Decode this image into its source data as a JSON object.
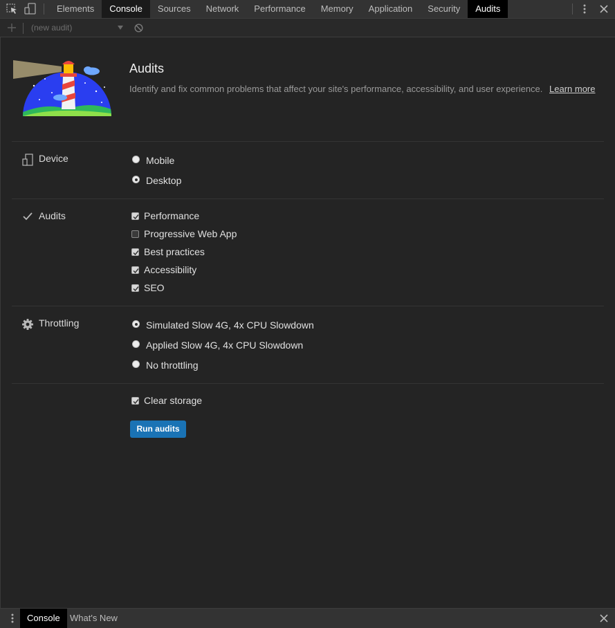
{
  "toolbar": {
    "tabs": [
      "Elements",
      "Console",
      "Sources",
      "Network",
      "Performance",
      "Memory",
      "Application",
      "Security",
      "Audits"
    ],
    "active_tab": "Audits"
  },
  "subbar": {
    "audit_select": "(new audit)"
  },
  "header": {
    "title": "Audits",
    "description": "Identify and fix common problems that affect your site's performance, accessibility, and user experience.",
    "learn_more": "Learn more"
  },
  "device": {
    "label": "Device",
    "options": [
      {
        "label": "Mobile",
        "selected": false
      },
      {
        "label": "Desktop",
        "selected": true
      }
    ]
  },
  "audits": {
    "label": "Audits",
    "options": [
      {
        "label": "Performance",
        "checked": true
      },
      {
        "label": "Progressive Web App",
        "checked": false
      },
      {
        "label": "Best practices",
        "checked": true
      },
      {
        "label": "Accessibility",
        "checked": true
      },
      {
        "label": "SEO",
        "checked": true
      }
    ]
  },
  "throttling": {
    "label": "Throttling",
    "options": [
      {
        "label": "Simulated Slow 4G, 4x CPU Slowdown",
        "selected": true
      },
      {
        "label": "Applied Slow 4G, 4x CPU Slowdown",
        "selected": false
      },
      {
        "label": "No throttling",
        "selected": false
      }
    ]
  },
  "clear_storage": {
    "label": "Clear storage",
    "checked": true
  },
  "run_button": "Run audits",
  "drawer": {
    "tabs": [
      "Console",
      "What's New"
    ],
    "active_tab": "Console"
  },
  "colors": {
    "accent": "#1a73b5",
    "background": "#242424",
    "toolbar": "#333333"
  }
}
